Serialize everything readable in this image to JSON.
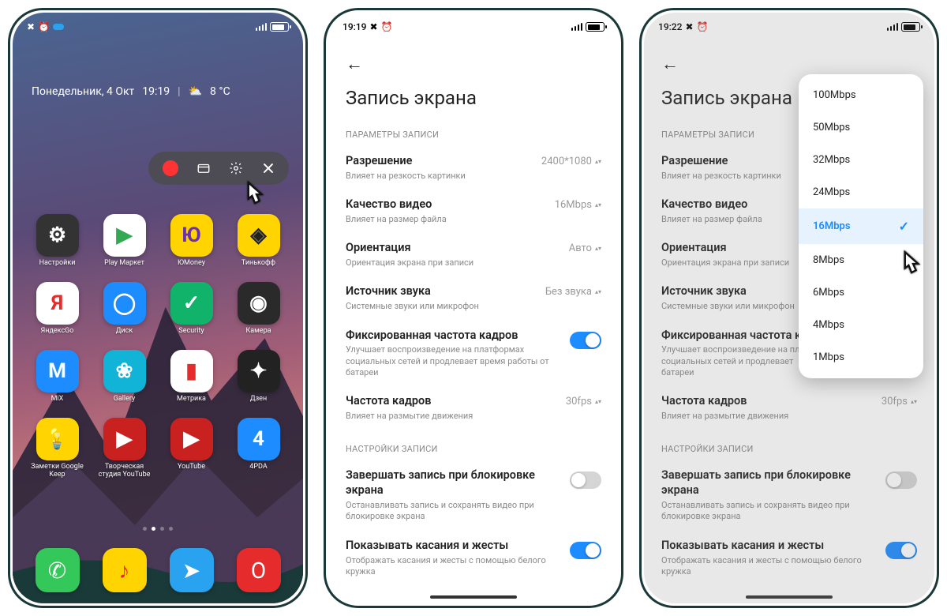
{
  "status": {
    "home_time": "",
    "set_time": "19:19",
    "dd_time": "19:22"
  },
  "home": {
    "widget_date": "Понедельник, 4 Окт",
    "widget_time": "19:19",
    "widget_temp": "8 °C",
    "apps": [
      {
        "label": "Настройки",
        "bg": "#333",
        "glyph": "⚙"
      },
      {
        "label": "Play Маркет",
        "bg": "#fff",
        "glyph": "▶",
        "fg": "#34a853"
      },
      {
        "label": "ЮMoney",
        "bg": "#ffd400",
        "glyph": "Ю",
        "fg": "#6b2fb3"
      },
      {
        "label": "Тинькофф",
        "bg": "#ffd400",
        "glyph": "◈",
        "fg": "#222"
      },
      {
        "label": "ЯндексGo",
        "bg": "#fff",
        "glyph": "Я",
        "fg": "#e52b2b"
      },
      {
        "label": "Диск",
        "bg": "#1d8cff",
        "glyph": "◯",
        "fg": "#fff"
      },
      {
        "label": "Security",
        "bg": "#11b36b",
        "glyph": "✓",
        "fg": "#fff"
      },
      {
        "label": "Камера",
        "bg": "#2a2a2a",
        "glyph": "◉",
        "fg": "#fff"
      },
      {
        "label": "MiX",
        "bg": "#1d8cff",
        "glyph": "M",
        "fg": "#fff"
      },
      {
        "label": "Gallery",
        "bg": "#11b4d6",
        "glyph": "❀",
        "fg": "#fff"
      },
      {
        "label": "Метрика",
        "bg": "#fff",
        "glyph": "▮",
        "fg": "#e52b2b"
      },
      {
        "label": "Дзен",
        "bg": "#222",
        "glyph": "✦",
        "fg": "#fff"
      },
      {
        "label": "Заметки Google Keep",
        "bg": "#ffd400",
        "glyph": "💡",
        "fg": "#fff"
      },
      {
        "label": "Творческая студия YouTube",
        "bg": "#c92020",
        "glyph": "▶",
        "fg": "#fff"
      },
      {
        "label": "YouTube",
        "bg": "#c92020",
        "glyph": "▶",
        "fg": "#fff"
      },
      {
        "label": "4PDA",
        "bg": "#1d8cff",
        "glyph": "4",
        "fg": "#fff"
      }
    ],
    "dock": [
      {
        "name": "phone",
        "bg": "#34c759",
        "glyph": "✆"
      },
      {
        "name": "music",
        "bg": "#ffd400",
        "glyph": "♪",
        "fg": "#e52b2b"
      },
      {
        "name": "telegram",
        "bg": "#29a3ef",
        "glyph": "➤"
      },
      {
        "name": "opera",
        "bg": "#e52b2b",
        "glyph": "O"
      }
    ]
  },
  "settings": {
    "title": "Запись экрана",
    "sec_params": "ПАРАМЕТРЫ ЗАПИСИ",
    "sec_rec": "НАСТРОЙКИ ЗАПИСИ",
    "rows": {
      "resolution": {
        "t": "Разрешение",
        "d": "Влияет на резкость картинки",
        "v": "2400*1080"
      },
      "quality": {
        "t": "Качество видео",
        "d": "Влияет на размер файла",
        "v": "16Mbps"
      },
      "orient": {
        "t": "Ориентация",
        "d": "Ориентация экрана при записи",
        "v": "Авто"
      },
      "audio": {
        "t": "Источник звука",
        "d": "Системные звуки или микрофон",
        "v": "Без звука"
      },
      "fixedfps": {
        "t": "Фиксированная частота кадров",
        "d": "Улучшает воспроизведение на платформах социальных сетей и продлевает время работы от батареи"
      },
      "fps": {
        "t": "Частота кадров",
        "d": "Влияет на размытие движения",
        "v": "30fps"
      },
      "endlock": {
        "t": "Завершать запись при блокировке экрана",
        "d": "Останавливать запись и сохранять видео при блокировке экрана"
      },
      "touches": {
        "t": "Показывать касания и жесты",
        "d": "Отображать касания и жесты с помощью белого кружка"
      }
    },
    "fixedfps_trunc": "Фиксированная частота к",
    "fixedfps_desc_trunc": "Улучшает воспроизведение на пл\nсоциальных сетей и продлевает\nбатареи"
  },
  "dropdown": {
    "options": [
      "100Mbps",
      "50Mbps",
      "32Mbps",
      "24Mbps",
      "16Mbps",
      "8Mbps",
      "6Mbps",
      "4Mbps",
      "1Mbps"
    ],
    "selected": "16Mbps"
  }
}
